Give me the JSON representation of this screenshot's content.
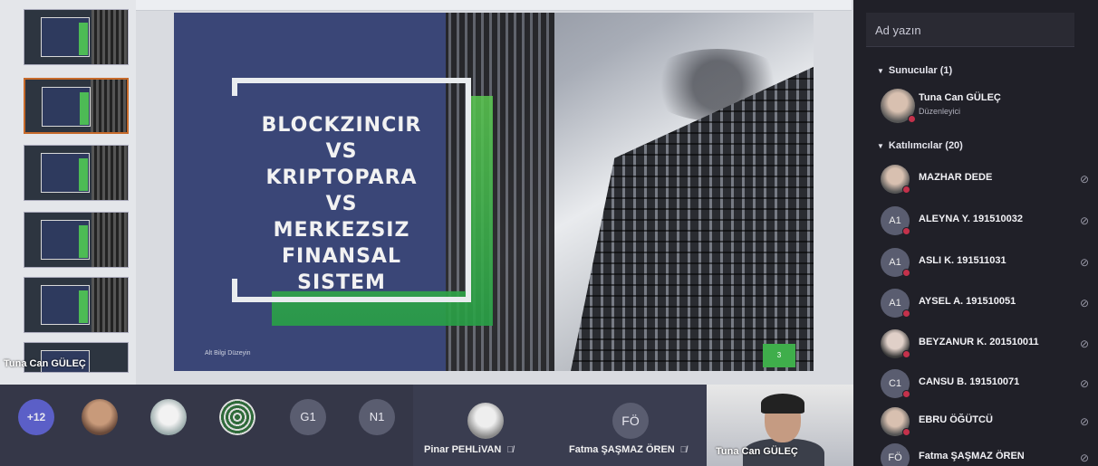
{
  "presentation": {
    "slide_title_lines": [
      "BLOCKZINCIR",
      "VS",
      "KRIPTOPARA",
      "VS",
      "MERKEZSIZ",
      "FINANSAL SISTEM"
    ],
    "slide_footer": "Alt Bilgi Düzeyin",
    "slide_number": "3",
    "presenter_tag": "Tuna Can GÜLEÇ"
  },
  "strip": {
    "more_count": "+12",
    "initial_avatars": [
      "G1",
      "N1"
    ],
    "tiles": [
      {
        "name": "Pinar PEHLiVAN"
      },
      {
        "name": "Fatma ŞAŞMAZ ÖREN",
        "initials": "FÖ"
      },
      {
        "name": "Tuna Can GÜLEÇ"
      }
    ]
  },
  "panel": {
    "search_placeholder": "Ad yazın",
    "presenters_header": "Sunucular (1)",
    "presenter": {
      "name": "Tuna Can GÜLEÇ",
      "role": "Düzenleyici"
    },
    "attendees_header": "Katılımcılar (20)",
    "attendees": [
      {
        "name": "MAZHAR DEDE",
        "initials": ""
      },
      {
        "name": "ALEYNA Y. 191510032",
        "initials": "A1"
      },
      {
        "name": "ASLI K. 191511031",
        "initials": "A1"
      },
      {
        "name": "AYSEL A. 191510051",
        "initials": "A1"
      },
      {
        "name": "BEYZANUR K. 201510011",
        "initials": ""
      },
      {
        "name": "CANSU B. 191510071",
        "initials": "C1"
      },
      {
        "name": "EBRU ÖĞÜTCÜ",
        "initials": ""
      },
      {
        "name": "Fatma ŞAŞMAZ ÖREN",
        "initials": "FÖ"
      }
    ]
  },
  "colors": {
    "accent_green": "#3fae4b",
    "slide_navy": "#3a4677",
    "teams_purple": "#5b5fc7",
    "status_red": "#c4314b"
  }
}
